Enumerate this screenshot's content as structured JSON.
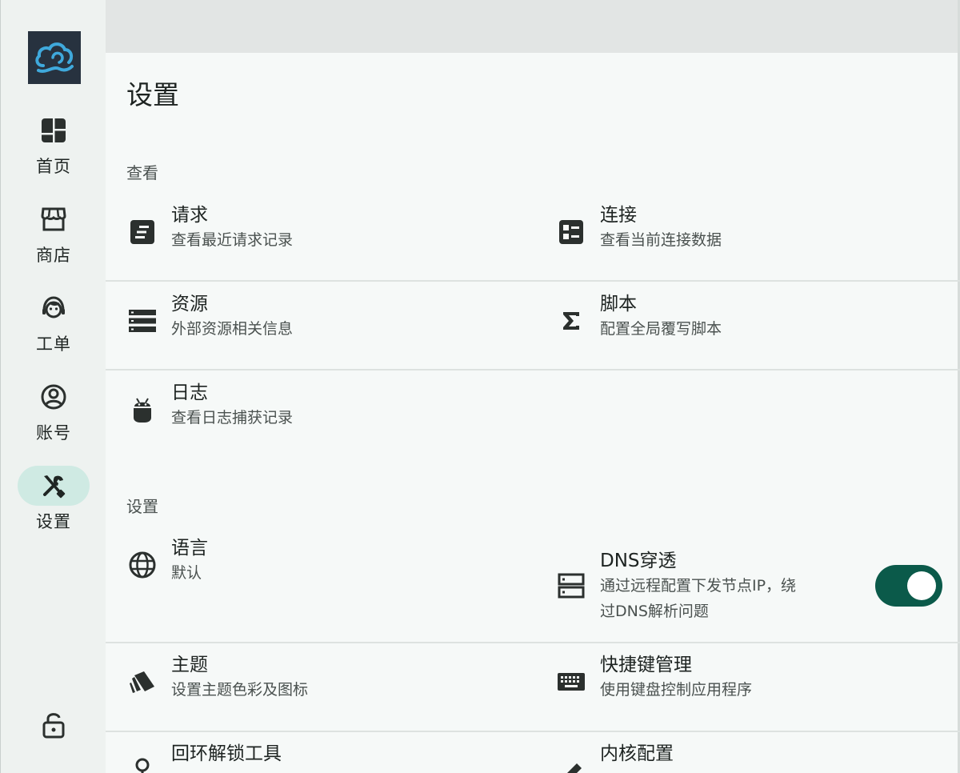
{
  "sidebar": {
    "items": [
      {
        "label": "首页",
        "icon": "dashboard-icon"
      },
      {
        "label": "商店",
        "icon": "store-icon"
      },
      {
        "label": "工单",
        "icon": "support-agent-icon"
      },
      {
        "label": "账号",
        "icon": "account-circle-icon"
      },
      {
        "label": "设置",
        "icon": "tools-icon",
        "active": true
      }
    ],
    "lock_icon": "lock-open-icon"
  },
  "page": {
    "title": "设置"
  },
  "sections": {
    "view": {
      "title": "查看",
      "items": {
        "requests": {
          "title": "请求",
          "subtitle": "查看最近请求记录",
          "icon": "request-icon"
        },
        "connections": {
          "title": "连接",
          "subtitle": "查看当前连接数据",
          "icon": "connections-icon"
        },
        "resources": {
          "title": "资源",
          "subtitle": "外部资源相关信息",
          "icon": "storage-icon"
        },
        "scripts": {
          "title": "脚本",
          "subtitle": "配置全局覆写脚本",
          "icon": "sigma-icon"
        },
        "logs": {
          "title": "日志",
          "subtitle": "查看日志捕获记录",
          "icon": "android-icon"
        }
      }
    },
    "settings": {
      "title": "设置",
      "items": {
        "language": {
          "title": "语言",
          "subtitle": "默认",
          "icon": "globe-icon"
        },
        "dns": {
          "title": "DNS穿透",
          "subtitle_line1": "通过远程配置下发节点IP，绕",
          "subtitle_line2": "过DNS解析问题",
          "icon": "dns-icon",
          "enabled": true
        },
        "theme": {
          "title": "主题",
          "subtitle": "设置主题色彩及图标",
          "icon": "theme-cards-icon"
        },
        "hotkeys": {
          "title": "快捷键管理",
          "subtitle": "使用键盘控制应用程序",
          "icon": "keyboard-icon"
        },
        "loopback": {
          "title": "回环解锁工具",
          "icon": "key-icon"
        },
        "core": {
          "title": "内核配置",
          "icon": "edit-icon"
        }
      }
    }
  },
  "colors": {
    "accent": "#0b5a4a",
    "active_nav_bg": "#cfeae3",
    "sidebar_bg": "#eef2f0",
    "main_bg": "#f6f9f8",
    "logo_bg": "#27323f",
    "logo_cloud": "#3fa9dc"
  }
}
